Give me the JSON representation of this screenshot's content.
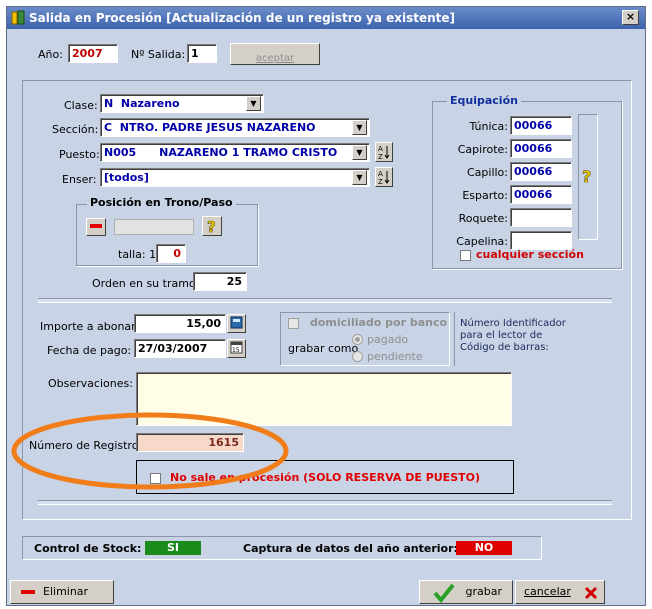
{
  "window": {
    "title": "Salida en Procesión [Actualización de un registro ya existente]",
    "close_label": "×"
  },
  "top": {
    "anio_label": "Año:",
    "anio_value": "2007",
    "salida_label": "Nº Salida:",
    "salida_value": "1",
    "aceptar_label": "aceptar"
  },
  "form": {
    "clase_label": "Clase:",
    "clase_code": "N",
    "clase_value": "Nazareno",
    "seccion_label": "Sección:",
    "seccion_code": "C",
    "seccion_value": "NTRO. PADRE JESUS NAZARENO",
    "puesto_label": "Puesto:",
    "puesto_code": "N005",
    "puesto_value": "NAZARENO 1 TRAMO CRISTO",
    "enser_label": "Enser:",
    "enser_value": "[todos]",
    "posicion_title": "Posición en Trono/Paso",
    "talla_label": "talla: 1,",
    "talla_value": "0",
    "orden_label": "Orden en su tramo:",
    "orden_value": "25"
  },
  "equipacion": {
    "title": "Equipación",
    "items": [
      {
        "label": "Túnica:",
        "value": "00066"
      },
      {
        "label": "Capirote:",
        "value": "00066"
      },
      {
        "label": "Capillo:",
        "value": "00066"
      },
      {
        "label": "Esparto:",
        "value": "00066"
      },
      {
        "label": "Roquete:",
        "value": ""
      },
      {
        "label": "Capelina:",
        "value": ""
      }
    ],
    "cualquier_label": "cualquier sección"
  },
  "pago": {
    "importe_label": "Importe a abonar:",
    "importe_value": "15,00",
    "fecha_label": "Fecha de pago:",
    "fecha_value": "27/03/2007",
    "domiciliado_label": "domiciliado por banco",
    "grabar_como_label": "grabar como",
    "pagado_label": "pagado",
    "pendiente_label": "pendiente",
    "numero_id_label": "Número Identificador para el lector de Código de barras:"
  },
  "observaciones_label": "Observaciones:",
  "registro_label": "Número de Registro:",
  "registro_value": "1615",
  "no_sale_label": "No sale en procesión (SOLO RESERVA DE PUESTO)",
  "status": {
    "stock_label": "Control de Stock:",
    "stock_value": "SI",
    "captura_label": "Captura de datos del año anterior:",
    "captura_value": "NO"
  },
  "buttons": {
    "eliminar": "Eliminar",
    "grabar": "grabar",
    "cancelar": "cancelar"
  },
  "colors": {
    "window_bg": "#c9d3e6",
    "stock_si": "#1a8a1a",
    "captura_no": "#e00000",
    "highlight_circle": "#f07d1a",
    "registro_field": "#f7d9cc",
    "observaciones_field": "#fffde6"
  }
}
